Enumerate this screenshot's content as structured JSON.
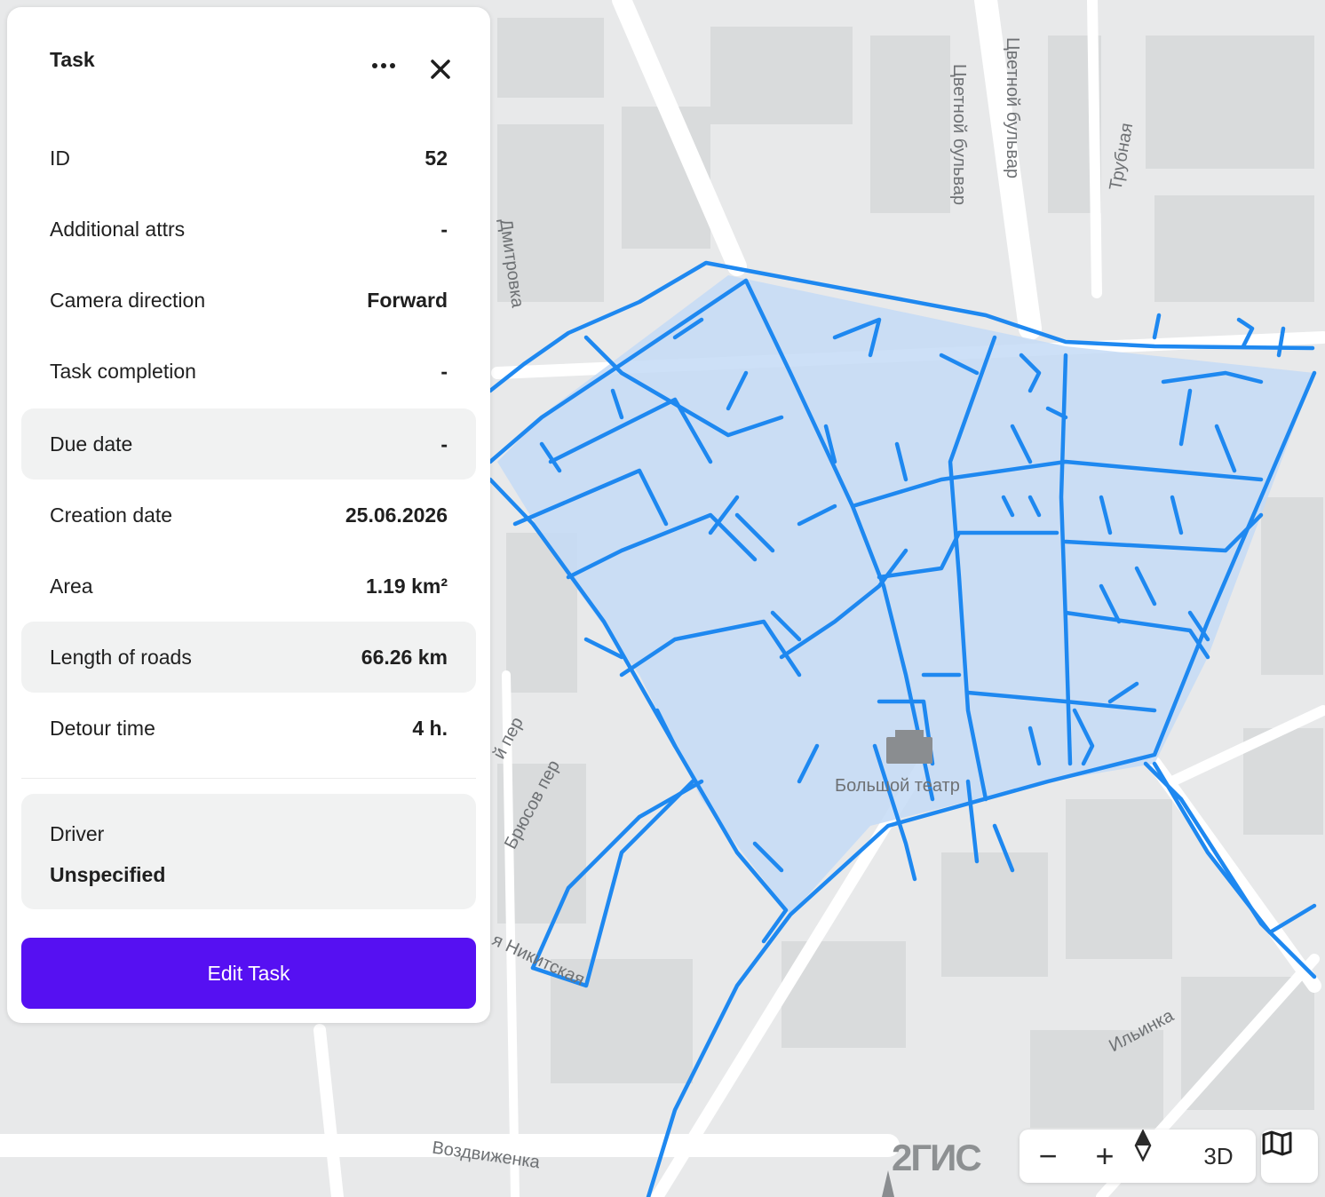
{
  "panel": {
    "title": "Task",
    "rows": [
      {
        "label": "ID",
        "value": "52"
      },
      {
        "label": "Additional attrs",
        "value": "-"
      },
      {
        "label": "Camera direction",
        "value": "Forward"
      },
      {
        "label": "Task completion",
        "value": "-"
      },
      {
        "label": "Due date",
        "value": "-"
      },
      {
        "label": "Creation date",
        "value": "25.06.2026"
      },
      {
        "label": "Area",
        "value": "1.19 km²"
      },
      {
        "label": "Length of roads",
        "value": "66.26 km"
      },
      {
        "label": "Detour time",
        "value": "4 h."
      }
    ],
    "driver": {
      "label": "Driver",
      "value": "Unspecified"
    },
    "edit_button": "Edit Task",
    "more_icon": "more-horizontal-icon",
    "close_icon": "close-icon"
  },
  "map": {
    "logo": "2ГИС",
    "controls": {
      "zoom_out": "−",
      "zoom_in": "+",
      "three_d": "3D"
    },
    "labels": {
      "tsvetnoy_1": "Цветной бульвар",
      "tsvetnoy_2": "Цветной бульвар",
      "trubnaya": "Трубная",
      "dmitrovka": "Дмитровка",
      "bryusov": "Брюсов пер",
      "pereulok": "й пер",
      "vozdvizhenka": "Воздвиженка",
      "ilyinka": "Ильинка",
      "bolshoi": "Большой театр",
      "nikitskaya": "я Никитская"
    },
    "route_color": "#1e88f0",
    "area_fill": "#c4daf6"
  }
}
